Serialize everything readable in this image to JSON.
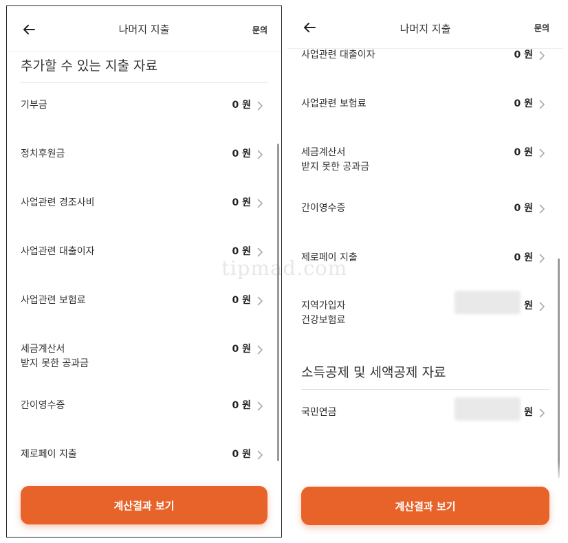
{
  "header": {
    "title": "나머지 지출",
    "inquiry_label": "문의"
  },
  "left": {
    "section_title": "추가할 수 있는 지출 자료",
    "items": [
      {
        "label": "기부금",
        "value": "0 원"
      },
      {
        "label": "정치후원금",
        "value": "0 원"
      },
      {
        "label": "사업관련 경조사비",
        "value": "0 원"
      },
      {
        "label": "사업관련 대출이자",
        "value": "0 원"
      },
      {
        "label": "사업관련 보험료",
        "value": "0 원"
      },
      {
        "label_line1": "세금계산서",
        "label_line2": "받지 못한 공과금",
        "value": "0 원"
      },
      {
        "label": "간이영수증",
        "value": "0 원"
      },
      {
        "label": "제로페이 지출",
        "value": "0 원"
      }
    ]
  },
  "right": {
    "items": [
      {
        "label": "사업관련 대출이자",
        "value": "0 원"
      },
      {
        "label": "사업관련 보험료",
        "value": "0 원"
      },
      {
        "label_line1": "세금계산서",
        "label_line2": "받지 못한 공과금",
        "value": "0 원"
      },
      {
        "label": "간이영수증",
        "value": "0 원"
      },
      {
        "label": "제로페이 지출",
        "value": "0 원"
      },
      {
        "label_line1": "지역가입자",
        "label_line2": "건강보험료",
        "value": "원"
      }
    ],
    "section2_title": "소득공제 및 세액공제 자료",
    "items2": [
      {
        "label": "국민연금",
        "value": "원"
      }
    ]
  },
  "cta_label": "계산결과 보기",
  "watermark": "tipmad.com",
  "colors": {
    "accent": "#e8632a",
    "text": "#222222",
    "divider": "#dddddd"
  },
  "icons": {
    "back": "arrow-left-icon",
    "chevron": "chevron-right-icon"
  }
}
